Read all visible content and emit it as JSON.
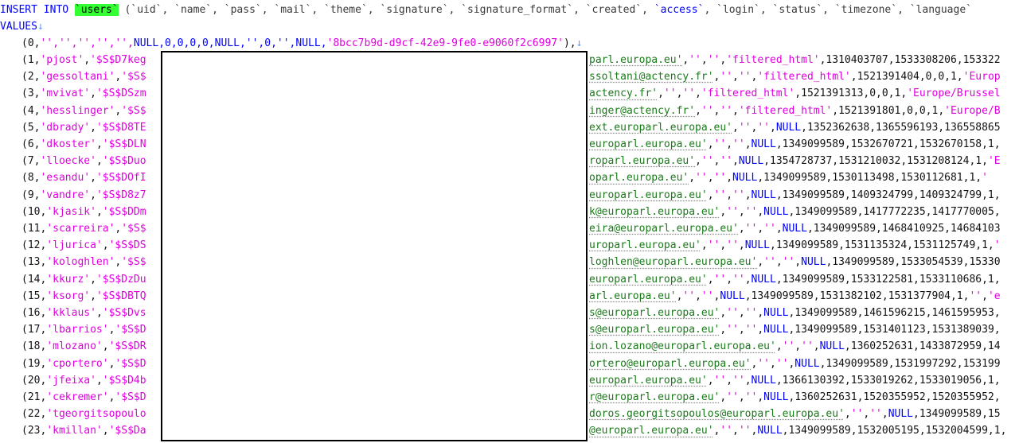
{
  "header": {
    "insert": "INSERT INTO",
    "table": "`users`",
    "columns_pre": " (`uid`, `name`, `pass`, `mail`, `theme`, `signature`, `signature_format`, `created`, ",
    "access": "`access`",
    "columns_post": ", `login`, `status`, `timezone`, `language`",
    "values": "VALUES",
    "eol": "↓"
  },
  "row0": {
    "prefix": "(0,",
    "empties": "'','','','','',",
    "rest": "NULL,0,0,0,0,NULL,'',0,'',NULL,",
    "uuid": "'8bcc7b9d-d9cf-42e9-9fe0-e9060f2c6997'",
    "tail": "),",
    "eol": "↓"
  },
  "rows": [
    {
      "left_num": "(1,",
      "left_name": "'pjost'",
      "left_pass": ",'$S$D7keg",
      "right_mail": "parl.europa.eu'",
      "right_rest": ",'','','filtered_html',1310403707,1533308206,153322"
    },
    {
      "left_num": "(2,",
      "left_name": "'gessoltani'",
      "left_pass": ",'$S$",
      "right_mail": "ssoltani@actency.fr'",
      "right_rest": ",'','','filtered_html',1521391404,0,0,1,'Europ"
    },
    {
      "left_num": "(3,",
      "left_name": "'mvivat'",
      "left_pass": ",'$S$DSzm",
      "right_mail": "actency.fr'",
      "right_rest": ",'','','filtered_html',1521391313,0,0,1,'Europe/Brussel"
    },
    {
      "left_num": "(4,",
      "left_name": "'hesslinger'",
      "left_pass": ",'$S$",
      "right_mail": "inger@actency.fr'",
      "right_rest": ",'','','filtered_html',1521391801,0,0,1,'Europe/B"
    },
    {
      "left_num": "(5,",
      "left_name": "'dbrady'",
      "left_pass": ",'$S$D8TE",
      "right_mail": "ext.europarl.europa.eu'",
      "right_rest": ",'','',NULL,1352362638,1365596193,136558865"
    },
    {
      "left_num": "(6,",
      "left_name": "'dkoster'",
      "left_pass": ",'$S$DLN",
      "right_mail": "europarl.europa.eu'",
      "right_rest": ",'','',NULL,1349099589,1532670721,1532670158,1,"
    },
    {
      "left_num": "(7,",
      "left_name": "'lloecke'",
      "left_pass": ",'$S$Duo",
      "right_mail": "roparl.europa.eu'",
      "right_rest": ",'','',NULL,1354728737,1531210032,1531208124,1,'E"
    },
    {
      "left_num": "(8,",
      "left_name": "'esandu'",
      "left_pass": ",'$S$DOfI",
      "right_mail": "oparl.europa.eu'",
      "right_rest": ",'','',NULL,1349099589,1530113498,1530112681,1,'"
    },
    {
      "left_num": "(9,",
      "left_name": "'vandre'",
      "left_pass": ",'$S$D8z7",
      "right_mail": "europarl.europa.eu'",
      "right_rest": ",'','',NULL,1349099589,1409324799,1409324799,1,"
    },
    {
      "left_num": "(10,",
      "left_name": "'kjasik'",
      "left_pass": ",'$S$DDm",
      "right_mail": "k@europarl.europa.eu'",
      "right_rest": ",'','',NULL,1349099589,1417772235,1417770005,"
    },
    {
      "left_num": "(11,",
      "left_name": "'scarreira'",
      "left_pass": ",'$S$",
      "right_mail": "eira@europarl.europa.eu'",
      "right_rest": ",'','',NULL,1349099589,1468410925,14684103"
    },
    {
      "left_num": "(12,",
      "left_name": "'ljurica'",
      "left_pass": ",'$S$DS",
      "right_mail": "uroparl.europa.eu'",
      "right_rest": ",'','',NULL,1349099589,1531135324,1531125749,1,'"
    },
    {
      "left_num": "(13,",
      "left_name": "'kologhlen'",
      "left_pass": ",'$S$",
      "right_mail": "loghlen@europarl.europa.eu'",
      "right_rest": ",'','',NULL,1349099589,1533054539,15330"
    },
    {
      "left_num": "(14,",
      "left_name": "'kkurz'",
      "left_pass": ",'$S$DzDu",
      "right_mail": "europarl.europa.eu'",
      "right_rest": ",'','',NULL,1349099589,1533122581,1533110686,1,"
    },
    {
      "left_num": "(15,",
      "left_name": "'ksorg'",
      "left_pass": ",'$S$DBTQ",
      "right_mail": "arl.europa.eu'",
      "right_rest": ",'','',NULL,1349099589,1531382102,1531377904,1,'','e"
    },
    {
      "left_num": "(16,",
      "left_name": "'kklaus'",
      "left_pass": ",'$S$Dvs",
      "right_mail": "s@europarl.europa.eu'",
      "right_rest": ",'','',NULL,1349099589,1461596215,1461595953,"
    },
    {
      "left_num": "(17,",
      "left_name": "'lbarrios'",
      "left_pass": ",'$S$D",
      "right_mail": "s@europarl.europa.eu'",
      "right_rest": ",'','',NULL,1349099589,1531401123,1531389039,"
    },
    {
      "left_num": "(18,",
      "left_name": "'mlozano'",
      "left_pass": ",'$S$DR",
      "right_mail": "ion.lozano@europarl.europa.eu'",
      "right_rest": ",'','',NULL,1360252631,1433872959,14"
    },
    {
      "left_num": "(19,",
      "left_name": "'cportero'",
      "left_pass": ",'$S$D",
      "right_mail": "ortero@europarl.europa.eu'",
      "right_rest": ",'','',NULL,1349099589,1531997292,153199"
    },
    {
      "left_num": "(20,",
      "left_name": "'jfeixa'",
      "left_pass": ",'$S$D4b",
      "right_mail": "europarl.europa.eu'",
      "right_rest": ",'','',NULL,1366130392,1533019262,1533019056,1,"
    },
    {
      "left_num": "(21,",
      "left_name": "'cekremer'",
      "left_pass": ",'$S$D",
      "right_mail": "r@europarl.europa.eu'",
      "right_rest": ",'','',NULL,1360252631,1520355952,1520355952,"
    },
    {
      "left_num": "(22,",
      "left_name": "'tgeorgitsopoulo",
      "left_pass": "",
      "right_mail": "doros.georgitsopoulos@europarl.europa.eu'",
      "right_rest": ",'','',NULL,1349099589,15"
    },
    {
      "left_num": "(23,",
      "left_name": "'kmillan'",
      "left_pass": ",'$S$Da",
      "right_mail": "@europarl.europa.eu'",
      "right_rest": ",'','',NULL,1349099589,1532005195,1532004599,1,"
    }
  ]
}
